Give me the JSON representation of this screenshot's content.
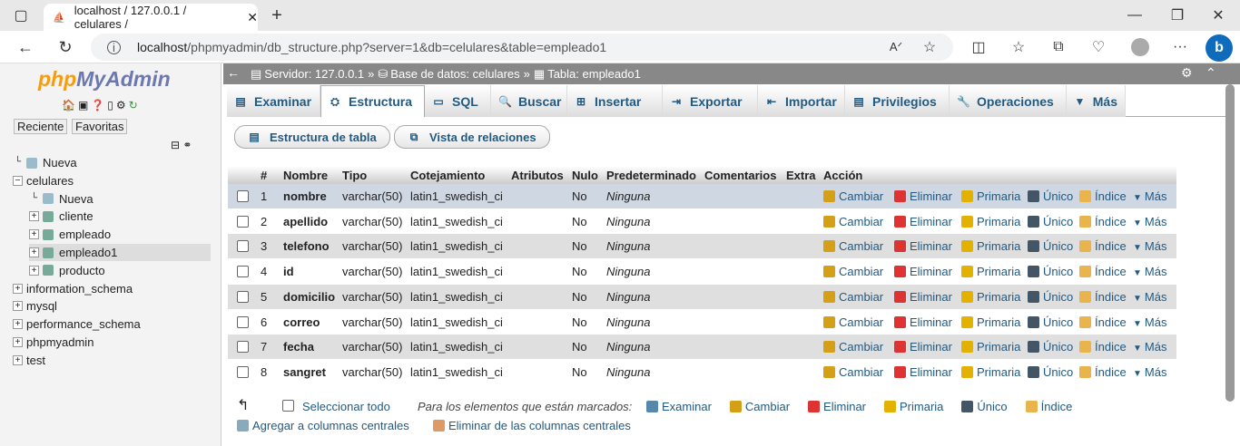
{
  "browser": {
    "tab_title": "localhost / 127.0.0.1 / celulares /",
    "url_host": "localhost",
    "url_path": "/phpmyadmin/db_structure.php?server=1&db=celulares&table=empleado1"
  },
  "nav": {
    "logo_php": "php",
    "logo_ma": "MyAdmin",
    "recent": "Reciente",
    "favorites": "Favoritas",
    "tree": [
      {
        "label": "Nueva",
        "indent": 0,
        "kind": "new"
      },
      {
        "label": "celulares",
        "indent": 0,
        "kind": "db",
        "open": true
      },
      {
        "label": "Nueva",
        "indent": 1,
        "kind": "new"
      },
      {
        "label": "cliente",
        "indent": 1,
        "kind": "table"
      },
      {
        "label": "empleado",
        "indent": 1,
        "kind": "table"
      },
      {
        "label": "empleado1",
        "indent": 1,
        "kind": "table",
        "selected": true
      },
      {
        "label": "producto",
        "indent": 1,
        "kind": "table"
      },
      {
        "label": "information_schema",
        "indent": 0,
        "kind": "db"
      },
      {
        "label": "mysql",
        "indent": 0,
        "kind": "db"
      },
      {
        "label": "performance_schema",
        "indent": 0,
        "kind": "db"
      },
      {
        "label": "phpmyadmin",
        "indent": 0,
        "kind": "db"
      },
      {
        "label": "test",
        "indent": 0,
        "kind": "db"
      }
    ]
  },
  "breadcrumb": {
    "server": "Servidor: 127.0.0.1",
    "sep1": "»",
    "database": "Base de datos: celulares",
    "sep2": "»",
    "table": "Tabla: empleado1"
  },
  "tabs": [
    "Examinar",
    "Estructura",
    "SQL",
    "Buscar",
    "Insertar",
    "Exportar",
    "Importar",
    "Privilegios",
    "Operaciones",
    "Más"
  ],
  "subtabs": [
    "Estructura de tabla",
    "Vista de relaciones"
  ],
  "table": {
    "headers": [
      "#",
      "Nombre",
      "Tipo",
      "Cotejamiento",
      "Atributos",
      "Nulo",
      "Predeterminado",
      "Comentarios",
      "Extra",
      "Acción"
    ],
    "rows": [
      {
        "n": "1",
        "name": "nombre",
        "type": "varchar(50)",
        "coll": "latin1_swedish_ci",
        "null": "No",
        "default": "Ninguna"
      },
      {
        "n": "2",
        "name": "apellido",
        "type": "varchar(50)",
        "coll": "latin1_swedish_ci",
        "null": "No",
        "default": "Ninguna"
      },
      {
        "n": "3",
        "name": "telefono",
        "type": "varchar(50)",
        "coll": "latin1_swedish_ci",
        "null": "No",
        "default": "Ninguna"
      },
      {
        "n": "4",
        "name": "id",
        "type": "varchar(50)",
        "coll": "latin1_swedish_ci",
        "null": "No",
        "default": "Ninguna"
      },
      {
        "n": "5",
        "name": "domicilio",
        "type": "varchar(50)",
        "coll": "latin1_swedish_ci",
        "null": "No",
        "default": "Ninguna"
      },
      {
        "n": "6",
        "name": "correo",
        "type": "varchar(50)",
        "coll": "latin1_swedish_ci",
        "null": "No",
        "default": "Ninguna"
      },
      {
        "n": "7",
        "name": "fecha",
        "type": "varchar(50)",
        "coll": "latin1_swedish_ci",
        "null": "No",
        "default": "Ninguna"
      },
      {
        "n": "8",
        "name": "sangret",
        "type": "varchar(50)",
        "coll": "latin1_swedish_ci",
        "null": "No",
        "default": "Ninguna"
      }
    ],
    "actions": [
      "Cambiar",
      "Eliminar",
      "Primaria",
      "Único",
      "Índice",
      "Más"
    ]
  },
  "footer": {
    "select_all": "Seleccionar todo",
    "marked": "Para los elementos que están marcados:",
    "bulk": [
      "Examinar",
      "Cambiar",
      "Eliminar",
      "Primaria",
      "Único",
      "Índice"
    ],
    "add_central": "Agregar a columnas centrales",
    "remove_central": "Eliminar de las columnas centrales"
  },
  "colors": {
    "link": "#235a81",
    "row_alt": "#dfdfdf",
    "row_hl": "#cfd7e3"
  }
}
